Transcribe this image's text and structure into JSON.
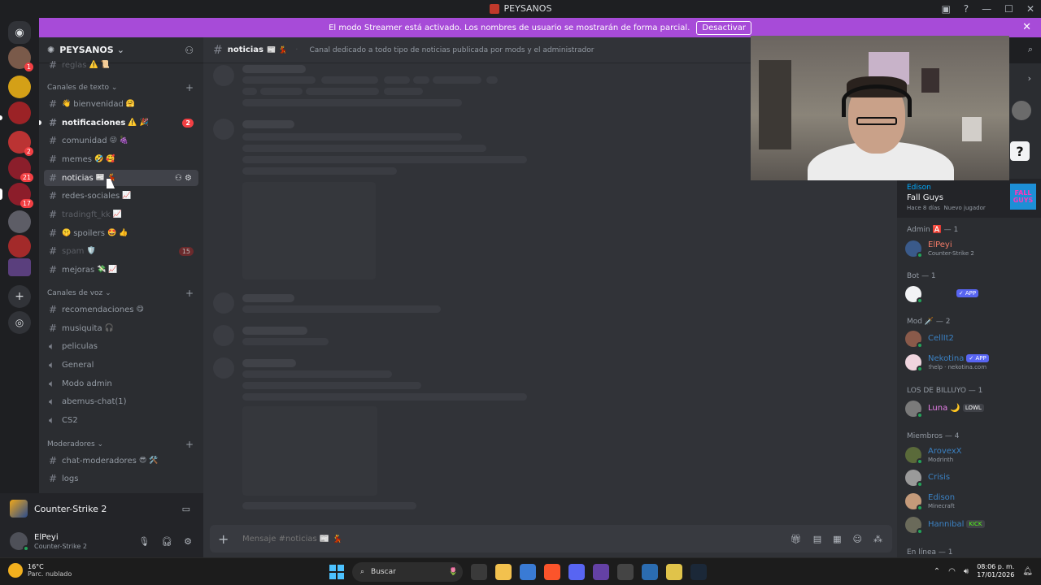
{
  "window": {
    "title": "PEYSANOS"
  },
  "streamer_bar": {
    "message": "El modo Streamer está activado. Los nombres de usuario se mostrarán de forma parcial.",
    "button": "Desactivar"
  },
  "guild_badges": [
    "1",
    "2",
    "21",
    "17"
  ],
  "server": {
    "name": "PEYSANOS"
  },
  "sidebar": {
    "partial_top": "reglas",
    "categories": {
      "text": "Canales de texto",
      "voice": "Canales de voz",
      "mods": "Moderadores"
    },
    "text_channels": [
      {
        "name": "bienvenidad",
        "emoji": "🤗",
        "prefix": "👋"
      },
      {
        "name": "notificaciones",
        "emoji": "⚠️ 🎉",
        "mention": "2"
      },
      {
        "name": "comunidad",
        "emoji": "😜 🍇"
      },
      {
        "name": "memes",
        "emoji": "🤣 🥰"
      },
      {
        "name": "noticias",
        "emoji": "📰 💃"
      },
      {
        "name": "redes-sociales",
        "emoji": "📈"
      },
      {
        "name": "tradingft_kk",
        "emoji": "📈"
      },
      {
        "name": "spoilers",
        "emoji": "🤩 👍",
        "prefix": "🤫"
      },
      {
        "name": "spam",
        "emoji": "🛡️",
        "mention": "15"
      },
      {
        "name": "mejoras",
        "emoji": "💸 📈"
      }
    ],
    "voice_channels": [
      {
        "name": "recomendaciones",
        "emoji": "😋"
      },
      {
        "name": "musiquita",
        "emoji": "🎧"
      },
      {
        "name": "peliculas"
      },
      {
        "name": "General"
      },
      {
        "name": "Modo admin"
      },
      {
        "name": "abemus-chat(1)"
      },
      {
        "name": "CS2"
      }
    ],
    "mod_channels": [
      {
        "name": "chat-moderadores",
        "emoji": "😎 🛠️"
      },
      {
        "name": "logs"
      }
    ]
  },
  "panel": {
    "activity": "Counter-Strike 2",
    "user": {
      "name": "ElPeyi",
      "status": "Counter-Strike 2"
    }
  },
  "channel_header": {
    "name": "noticias",
    "emoji": "📰 💃",
    "description": "Canal dedicado a todo tipo de noticias publicada por mods y el administrador"
  },
  "composer": {
    "placeholder": "Mensaje #noticias 📰 💃"
  },
  "members": {
    "activity_card": {
      "user": "Edison",
      "game": "Fall Guys",
      "meta_time": "Hace 8 días",
      "meta_role": "Nuevo jugador",
      "logo": "FALL GUYS"
    },
    "groups": {
      "admin": "Admin 🅰️ — 1",
      "bot": "Bot — 1",
      "mod": "Mod 🗡️ — 2",
      "billuyo": "LOS DE BILLUYO — 1",
      "miembros": "Miembros — 4",
      "online": "En línea — 1"
    },
    "list": {
      "elpeyi": {
        "name": "ElPeyi",
        "sub": "Counter-Strike 2",
        "color": "#f47b67"
      },
      "bot": {
        "tag": "✓ APP"
      },
      "cellit2": {
        "name": "CellIt2",
        "color": "#3b82c4"
      },
      "nekotina": {
        "name": "Nekotina",
        "tag": "✓ APP",
        "sub": "!help · nekotina.com",
        "color": "#3b82c4"
      },
      "luna": {
        "name": "Luna 🌙",
        "tag": "LOWL",
        "color": "#e57ee6"
      },
      "arovexx": {
        "name": "ArovexX",
        "sub": "Modrinth",
        "color": "#3b82c4"
      },
      "crisis": {
        "name": "Crisis",
        "color": "#3b82c4"
      },
      "edison": {
        "name": "Edison",
        "sub": "Minecraft",
        "color": "#3b82c4"
      },
      "hannibal": {
        "name": "Hannibal",
        "tag": "KICK",
        "color": "#3b82c4"
      }
    }
  },
  "taskbar": {
    "temp": "16°C",
    "condition": "Parc. nublado",
    "search": "Buscar",
    "time": "08:06 p. m.",
    "date": "17/01/2026"
  }
}
